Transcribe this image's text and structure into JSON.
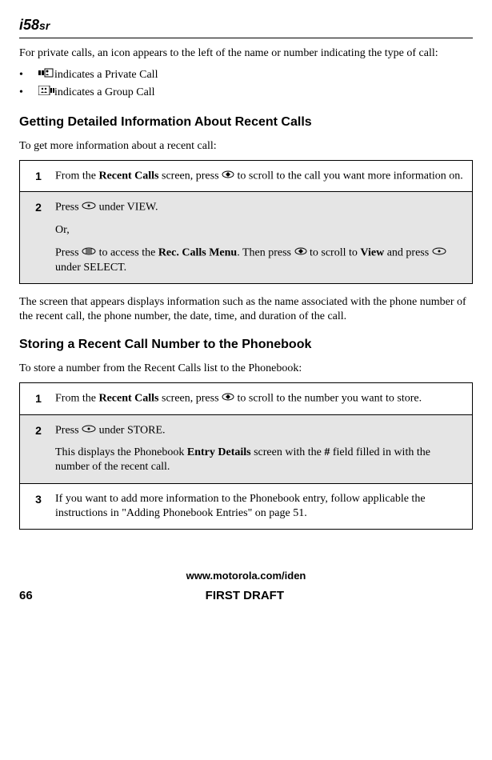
{
  "header": {
    "logo_main": "i58",
    "logo_sub": "sr"
  },
  "intro": {
    "private_calls_text": "For private calls, an icon appears to the left of the name or number indicating the type of call:",
    "bullet1": " indicates a Private Call",
    "bullet2": " indicates a Group Call"
  },
  "section1": {
    "heading": "Getting Detailed Information About Recent Calls",
    "intro_text": "To get more information about a recent call:",
    "step1_num": "1",
    "step1_a": "From the ",
    "step1_b": "Recent Calls",
    "step1_c": " screen, press ",
    "step1_d": " to scroll to the call you want more information on.",
    "step2_num": "2",
    "step2_a": "Press ",
    "step2_b": " under VIEW.",
    "step2_or": "Or,",
    "step2_c": "Press ",
    "step2_d": " to access the ",
    "step2_e": "Rec. Calls Menu",
    "step2_f": ". Then press ",
    "step2_g": " to scroll to ",
    "step2_h": "View",
    "step2_i": " and press ",
    "step2_j": " under SELECT.",
    "after_text": "The screen that appears displays information such as the name associated with the phone number of the recent call, the phone number, the date, time, and duration of the call."
  },
  "section2": {
    "heading": "Storing a Recent Call Number to the Phonebook",
    "intro_text": "To store a number from the Recent Calls list to the Phonebook:",
    "step1_num": "1",
    "step1_a": "From the ",
    "step1_b": "Recent Calls",
    "step1_c": " screen, press ",
    "step1_d": " to scroll to the number you want to store.",
    "step2_num": "2",
    "step2_a": "Press ",
    "step2_b": " under STORE.",
    "step2_c": "This displays the Phonebook ",
    "step2_d": "Entry Details",
    "step2_e": " screen with the ",
    "step2_f": "#",
    "step2_g": " field filled in with the number of the recent call.",
    "step3_num": "3",
    "step3_text": "If you want to add more information to the Phonebook entry, follow applicable the instructions in \"Adding Phonebook Entries\" on page 51."
  },
  "footer": {
    "url": "www.motorola.com/iden",
    "page_num": "66",
    "draft": "FIRST DRAFT"
  }
}
